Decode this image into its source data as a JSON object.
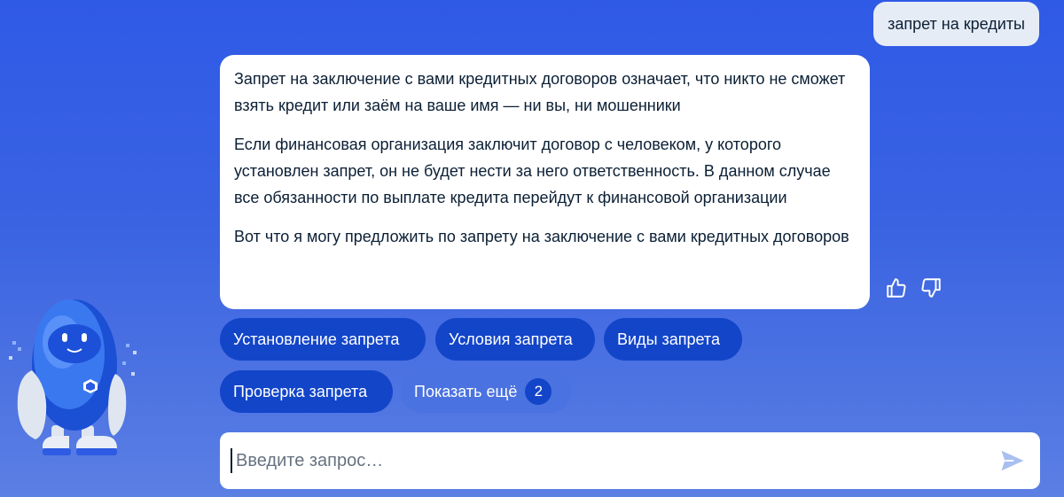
{
  "user_message": "запрет на кредиты",
  "bot_message": {
    "paragraphs": [
      "Запрет на заключение с вами кредитных договоров означает, что никто не сможет взять кредит или заём на ваше имя — ни вы, ни мошенники",
      "Если финансовая организация заключит договор с человеком, у которого установлен запрет, он не будет нести за него ответственность. В данном случае все обязанности по выплате кредита перейдут к финансовой организации",
      "Вот что я могу предложить по запрету на заключение с вами кредитных договоров"
    ]
  },
  "feedback": {
    "like_icon": "thumbs-up-icon",
    "dislike_icon": "thumbs-down-icon"
  },
  "suggestions": [
    "Установление запрета",
    "Условия запрета",
    "Виды запрета",
    "Проверка запрета"
  ],
  "show_more": {
    "label": "Показать ещё",
    "count": "2"
  },
  "input": {
    "placeholder": "Введите запрос…",
    "value": ""
  },
  "send_icon": "send-icon",
  "colors": {
    "background": "#3a63e2",
    "chip": "#1345c9",
    "chip_more": "#4a72e0",
    "user_bubble": "#e6ecf6",
    "text": "#0b1f35"
  }
}
